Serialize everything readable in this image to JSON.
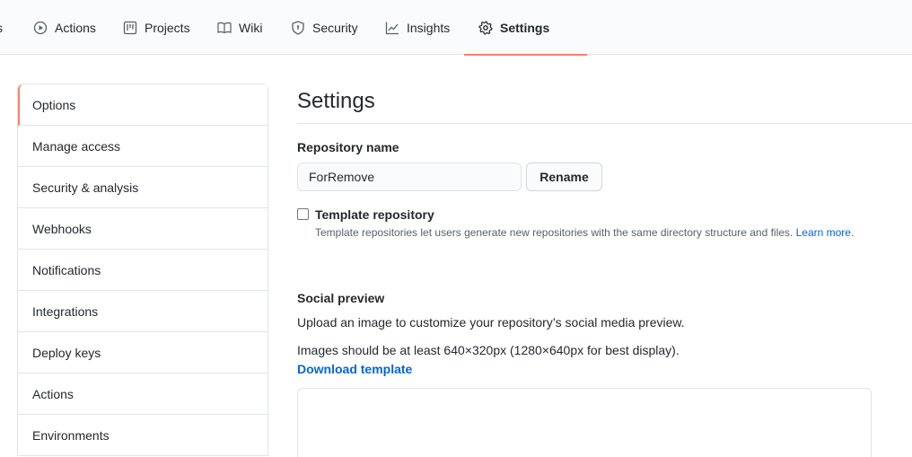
{
  "topnav": {
    "tabs": [
      {
        "label": "s",
        "icon": "none"
      },
      {
        "label": "Actions",
        "icon": "play-icon"
      },
      {
        "label": "Projects",
        "icon": "project-icon"
      },
      {
        "label": "Wiki",
        "icon": "book-icon"
      },
      {
        "label": "Security",
        "icon": "shield-icon"
      },
      {
        "label": "Insights",
        "icon": "graph-icon"
      },
      {
        "label": "Settings",
        "icon": "gear-icon",
        "active": true
      }
    ],
    "active_underline_color": "#f9826c"
  },
  "sidebar": {
    "items": [
      {
        "label": "Options",
        "active": true
      },
      {
        "label": "Manage access"
      },
      {
        "label": "Security & analysis"
      },
      {
        "label": "Webhooks"
      },
      {
        "label": "Notifications"
      },
      {
        "label": "Integrations"
      },
      {
        "label": "Deploy keys"
      },
      {
        "label": "Actions"
      },
      {
        "label": "Environments"
      }
    ]
  },
  "main": {
    "title": "Settings",
    "repo_name_label": "Repository name",
    "repo_name_value": "ForRemove",
    "rename_button": "Rename",
    "template_checkbox_label": "Template repository",
    "template_checked": false,
    "template_note": "Template repositories let users generate new repositories with the same directory structure and files.",
    "learn_more": "Learn more.",
    "social_preview_label": "Social preview",
    "social_preview_desc": "Upload an image to customize your repository’s social media preview.",
    "image_size_note": "Images should be at least 640×320px (1280×640px for best display).",
    "download_template": "Download template"
  },
  "colors": {
    "accent": "#f9826c",
    "link": "#0366d6",
    "border": "#e1e4e8"
  }
}
